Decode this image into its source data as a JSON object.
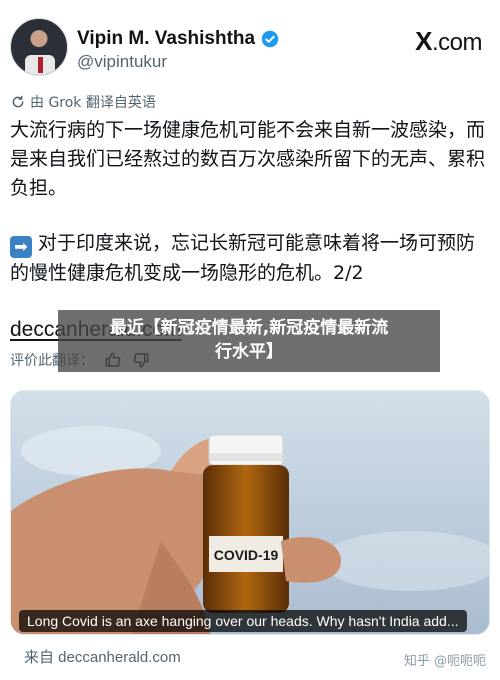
{
  "author": {
    "name": "Vipin M. Vashishtha",
    "handle": "@vipintukur",
    "verified_icon": "verified-badge-icon"
  },
  "brand": {
    "logo_text": ".com",
    "logo_x": "X"
  },
  "translation": {
    "label": "由 Grok 翻译自英语",
    "icon": "refresh-icon"
  },
  "tweet": {
    "paragraph1": "大流行病的下一场健康危机可能不会来自新一波感染，而是来自我们已经熬过的数百万次感染所留下的无声、累积负担。",
    "paragraph2_emoji": "➡",
    "paragraph2": "对于印度来说，忘记长新冠可能意味着将一场可预防的慢性健康危机变成一场隐形的危机。2/2"
  },
  "link": {
    "text": "deccanherald.com"
  },
  "rating": {
    "label": "评价此翻译："
  },
  "overlay": {
    "line1": "最近【新冠疫情最新,新冠疫情最新流",
    "line2": "行水平】"
  },
  "card": {
    "caption": "Long Covid is an axe hanging over our heads. Why hasn't India add...",
    "bottle_label": "COVID-19"
  },
  "source": {
    "text": "来自 deccanherald.com"
  },
  "watermark": {
    "text": "知乎 @呃呃呃"
  },
  "colors": {
    "verified": "#1d9bf0",
    "text": "#0f1419",
    "muted": "#536471"
  }
}
